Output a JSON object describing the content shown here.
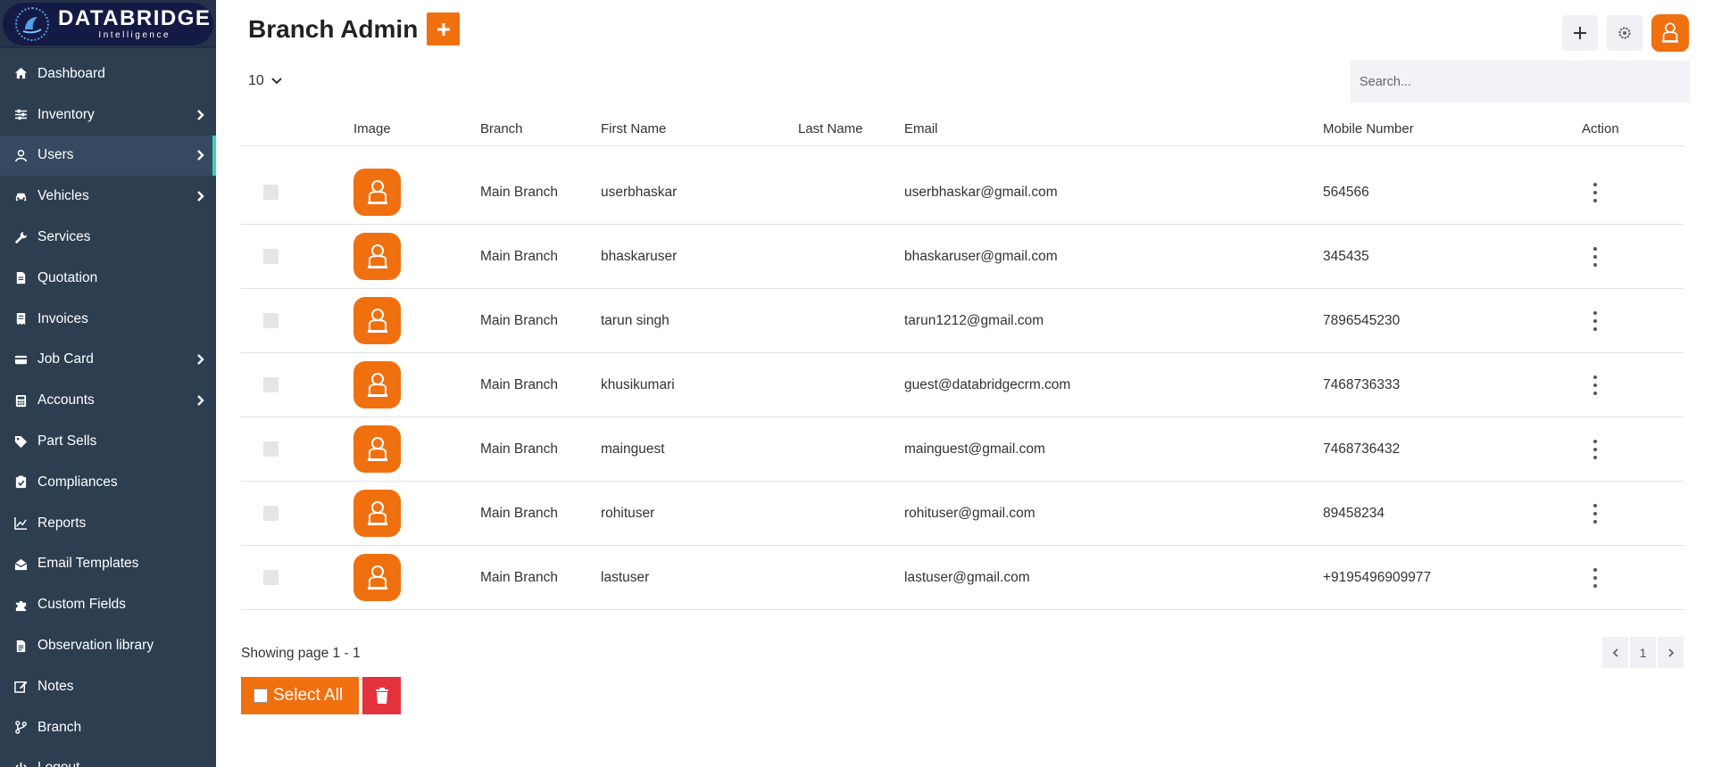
{
  "brand": {
    "title": "DATABRIDGE",
    "subtitle": "Intelligence",
    "accent_color": "#f0700f",
    "sidebar_color": "#2d3e50",
    "active_indicator_color": "#3ad1b4"
  },
  "sidebar": {
    "items": [
      {
        "label": "Dashboard",
        "icon": "home-icon",
        "has_children": false,
        "active": false
      },
      {
        "label": "Inventory",
        "icon": "sliders-icon",
        "has_children": true,
        "active": false
      },
      {
        "label": "Users",
        "icon": "user-icon",
        "has_children": true,
        "active": true
      },
      {
        "label": "Vehicles",
        "icon": "car-icon",
        "has_children": true,
        "active": false
      },
      {
        "label": "Services",
        "icon": "wrench-icon",
        "has_children": false,
        "active": false
      },
      {
        "label": "Quotation",
        "icon": "document-icon",
        "has_children": false,
        "active": false
      },
      {
        "label": "Invoices",
        "icon": "invoice-icon",
        "has_children": false,
        "active": false
      },
      {
        "label": "Job Card",
        "icon": "card-icon",
        "has_children": true,
        "active": false
      },
      {
        "label": "Accounts",
        "icon": "calculator-icon",
        "has_children": true,
        "active": false
      },
      {
        "label": "Part Sells",
        "icon": "tag-icon",
        "has_children": false,
        "active": false
      },
      {
        "label": "Compliances",
        "icon": "clipboard-check-icon",
        "has_children": false,
        "active": false
      },
      {
        "label": "Reports",
        "icon": "chart-line-icon",
        "has_children": false,
        "active": false
      },
      {
        "label": "Email Templates",
        "icon": "envelope-open-icon",
        "has_children": false,
        "active": false
      },
      {
        "label": "Custom Fields",
        "icon": "puzzle-icon",
        "has_children": false,
        "active": false
      },
      {
        "label": "Observation library",
        "icon": "file-icon",
        "has_children": false,
        "active": false
      },
      {
        "label": "Notes",
        "icon": "edit-icon",
        "has_children": false,
        "active": false
      },
      {
        "label": "Branch",
        "icon": "branch-icon",
        "has_children": false,
        "active": false
      },
      {
        "label": "Logout",
        "icon": "power-icon",
        "has_children": false,
        "active": false
      }
    ]
  },
  "header": {
    "title": "Branch Admin"
  },
  "toolbar": {
    "page_size": "10",
    "search_placeholder": "Search..."
  },
  "table": {
    "columns": [
      "Image",
      "Branch",
      "First Name",
      "Last Name",
      "Email",
      "Mobile Number",
      "Action"
    ],
    "rows": [
      {
        "branch": "Main Branch",
        "first_name": "userbhaskar",
        "last_name": "",
        "email": "userbhaskar@gmail.com",
        "mobile": "564566"
      },
      {
        "branch": "Main Branch",
        "first_name": "bhaskaruser",
        "last_name": "",
        "email": "bhaskaruser@gmail.com",
        "mobile": "345435"
      },
      {
        "branch": "Main Branch",
        "first_name": "tarun singh",
        "last_name": "",
        "email": "tarun1212@gmail.com",
        "mobile": "7896545230"
      },
      {
        "branch": "Main Branch",
        "first_name": "khusikumari",
        "last_name": "",
        "email": "guest@databridgecrm.com",
        "mobile": "7468736333"
      },
      {
        "branch": "Main Branch",
        "first_name": "mainguest",
        "last_name": "",
        "email": "mainguest@gmail.com",
        "mobile": "7468736432"
      },
      {
        "branch": "Main Branch",
        "first_name": "rohituser",
        "last_name": "",
        "email": "rohituser@gmail.com",
        "mobile": "89458234"
      },
      {
        "branch": "Main Branch",
        "first_name": "lastuser",
        "last_name": "",
        "email": "lastuser@gmail.com",
        "mobile": "+9195496909977"
      }
    ]
  },
  "footer": {
    "showing": "Showing page 1 - 1",
    "current_page": "1",
    "select_all_label": "Select All"
  }
}
